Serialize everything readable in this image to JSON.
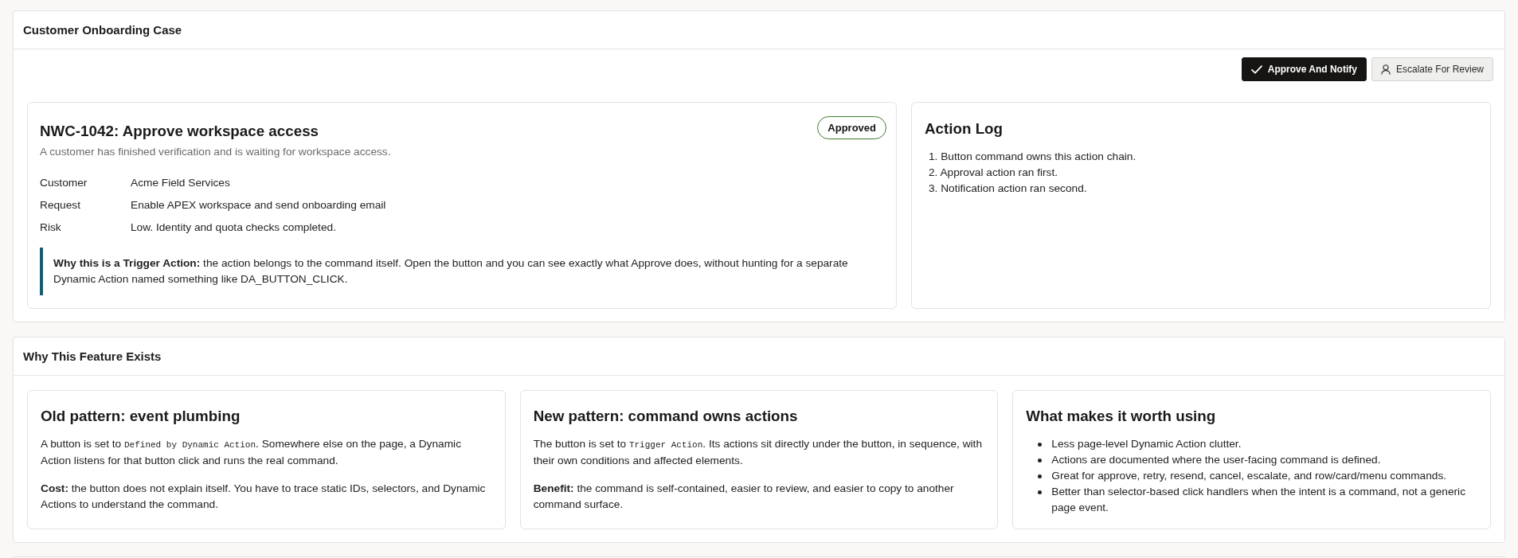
{
  "case_region": {
    "title": "Customer Onboarding Case",
    "buttons": [
      {
        "label": "Approve And Notify",
        "kind": "primary"
      },
      {
        "label": "Escalate For Review",
        "kind": "secondary"
      }
    ],
    "case_card": {
      "title": "NWC-1042: Approve workspace access",
      "status": "Approved",
      "summary": "A customer has finished verification and is waiting for workspace access.",
      "details": [
        {
          "label": "Customer",
          "value": "Acme Field Services"
        },
        {
          "label": "Request",
          "value": "Enable APEX workspace and send onboarding email"
        },
        {
          "label": "Risk",
          "value": "Low. Identity and quota checks completed."
        }
      ],
      "callout": "**Why this is a Trigger Action:** the action belongs to the command itself. Open the button and you can see exactly what Approve does, without hunting for a separate Dynamic Action named something like DA_BUTTON_CLICK."
    },
    "action_log": {
      "title": "Action Log",
      "entries": [
        "1. Button command owns this action chain.",
        "2. Approval action ran first.",
        "3. Notification action ran second."
      ]
    }
  },
  "feature_region": {
    "title": "Why This Feature Exists",
    "cards": [
      {
        "kind": "paragraphs",
        "title": "Old pattern: event plumbing",
        "paragraphs": [
          [
            {
              "kind": "plain",
              "text": "A button is set to "
            },
            {
              "kind": "code",
              "text": "Defined by Dynamic Action"
            },
            {
              "kind": "plain",
              "text": ". Somewhere else on the page, a Dynamic Action listens for that button click and runs the real command."
            }
          ],
          [
            {
              "kind": "plain",
              "text": "**Cost:** the button does not explain itself. You have to trace static IDs, selectors, and Dynamic Actions to understand the command."
            }
          ]
        ]
      },
      {
        "kind": "paragraphs",
        "title": "New pattern: command owns actions",
        "paragraphs": [
          [
            {
              "kind": "plain",
              "text": "The button is set to "
            },
            {
              "kind": "code",
              "text": "Trigger Action"
            },
            {
              "kind": "plain",
              "text": ". Its actions sit directly under the button, in sequence, with their own conditions and affected elements."
            }
          ],
          [
            {
              "kind": "plain",
              "text": "**Benefit:** the command is self-contained, easier to review, and easier to copy to another command surface."
            }
          ]
        ]
      },
      {
        "kind": "bullets",
        "title": "What makes it worth using",
        "items": [
          "Less page-level Dynamic Action clutter.",
          "Actions are documented where the user-facing command is defined.",
          "Great for approve, retry, resend, cancel, escalate, and row/card/menu commands.",
          "Better than selector-based click handlers when the intent is a command, not a generic page event."
        ]
      }
    ]
  }
}
